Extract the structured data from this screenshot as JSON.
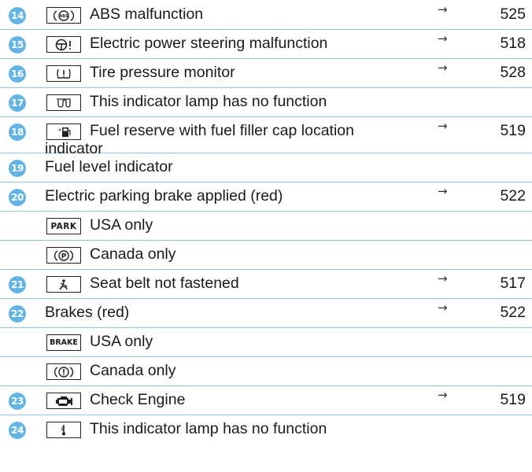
{
  "rows": [
    {
      "num": "14",
      "icon": "abs-icon",
      "text": "ABS malfunction",
      "arrow": "→",
      "page": "525"
    },
    {
      "num": "15",
      "icon": "power-steering-icon",
      "text": "Electric power steering malfunction",
      "arrow": "→",
      "page": "518"
    },
    {
      "num": "16",
      "icon": "tire-pressure-icon",
      "text": "Tire pressure monitor",
      "arrow": "→",
      "page": "528"
    },
    {
      "num": "17",
      "icon": "glow-plug-icon",
      "text": "This indicator lamp has no function"
    },
    {
      "num": "18",
      "icon": "fuel-reserve-icon",
      "text": "Fuel reserve with fuel filler cap location indicator",
      "arrow": "→",
      "page": "519"
    },
    {
      "num": "19",
      "text": "Fuel level indicator"
    },
    {
      "num": "20",
      "text": "Electric parking brake applied (red)",
      "arrow": "→",
      "page": "522"
    },
    {
      "box_text": "PARK",
      "text": "USA only"
    },
    {
      "icon": "parking-circle-icon",
      "text": "Canada only"
    },
    {
      "num": "21",
      "icon": "seat-belt-icon",
      "text": "Seat belt not fastened",
      "arrow": "→",
      "page": "517"
    },
    {
      "num": "22",
      "text": "Brakes (red)",
      "arrow": "→",
      "page": "522"
    },
    {
      "box_text": "BRAKE",
      "text": "USA only"
    },
    {
      "icon": "brake-warning-icon",
      "text": "Canada only"
    },
    {
      "num": "23",
      "icon": "check-engine-icon",
      "text": "Check Engine",
      "arrow": "→",
      "page": "519"
    },
    {
      "num": "24",
      "icon": "coolant-icon",
      "text": "This indicator lamp has no function"
    }
  ]
}
